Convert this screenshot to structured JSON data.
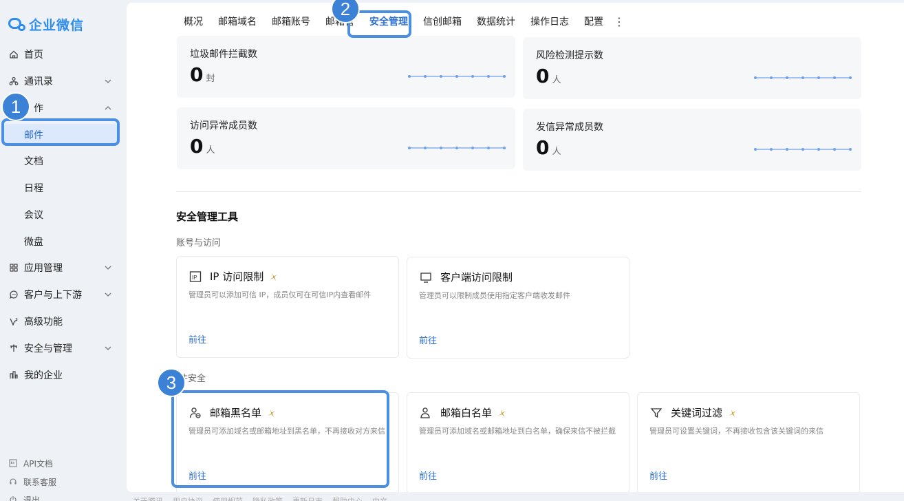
{
  "app": {
    "title": "企业微信"
  },
  "sidebar": {
    "items": [
      {
        "label": "首页",
        "icon": "home-icon"
      },
      {
        "label": "通讯录",
        "icon": "contacts-icon"
      },
      {
        "label": "作",
        "icon": "work-icon"
      },
      {
        "label": "应用管理",
        "icon": "apps-icon"
      },
      {
        "label": "客户与上下游",
        "icon": "customer-icon"
      },
      {
        "label": "高级功能",
        "icon": "advanced-icon"
      },
      {
        "label": "安全与管理",
        "icon": "security-icon"
      },
      {
        "label": "我的企业",
        "icon": "enterprise-icon"
      }
    ],
    "sub_items": [
      {
        "label": "邮件",
        "active": true
      },
      {
        "label": "文档"
      },
      {
        "label": "日程"
      },
      {
        "label": "会议"
      },
      {
        "label": "微盘"
      }
    ],
    "footer": [
      {
        "label": "API文档",
        "icon": "api-doc-icon"
      },
      {
        "label": "联系客服",
        "icon": "headset-icon"
      },
      {
        "label": "退出",
        "icon": "power-icon"
      }
    ]
  },
  "tabs": {
    "items": [
      {
        "label": "概况"
      },
      {
        "label": "邮箱域名"
      },
      {
        "label": "邮箱账号"
      },
      {
        "label": "邮箱管"
      },
      {
        "label": "安全管理",
        "active": true
      },
      {
        "label": "信创邮箱"
      },
      {
        "label": "数据统计"
      },
      {
        "label": "操作日志"
      },
      {
        "label": "配置"
      }
    ],
    "more_icon": "more-vertical-icon"
  },
  "stats": [
    {
      "title": "垃圾邮件拦截数",
      "value": "0",
      "unit": "封",
      "trend": [
        0,
        0,
        0,
        0,
        0,
        0,
        0
      ]
    },
    {
      "title": "风险检测提示数",
      "value": "0",
      "unit": "人",
      "trend": [
        0,
        0,
        0,
        0,
        0,
        0,
        0
      ]
    },
    {
      "title": "访问异常成员数",
      "value": "0",
      "unit": "人",
      "trend": [
        0,
        0,
        0,
        0,
        0,
        0,
        0
      ]
    },
    {
      "title": "发信异常成员数",
      "value": "0",
      "unit": "人",
      "trend": [
        0,
        0,
        0,
        0,
        0,
        0,
        0
      ]
    }
  ],
  "tools": {
    "section_title": "安全管理工具",
    "account_group": "账号与访问",
    "mail_group": "件安全",
    "account_cards": [
      {
        "name": "IP 访问限制",
        "desc": "管理员可以添加可信 IP，成员仅可在可信IP内查看邮件",
        "link": "前往",
        "icon": "ip-icon"
      },
      {
        "name": "客户端访问限制",
        "desc": "管理员可以限制成员使用指定客户端收发邮件",
        "link": "前往",
        "icon": "monitor-icon"
      }
    ],
    "mail_cards": [
      {
        "name": "邮箱黑名单",
        "desc": "管理员可添加域名或邮箱地址到黑名单，不再接收对方来信",
        "link": "前往",
        "icon": "user-block-icon"
      },
      {
        "name": "邮箱白名单",
        "desc": "管理员可添加域名或邮箱地址到白名单，确保来信不被拦截",
        "link": "前往",
        "icon": "user-allow-icon"
      },
      {
        "name": "关键词过滤",
        "desc": "管理员可设置关键词，不再接收包含该关键词的来信",
        "link": "前往",
        "icon": "filter-icon"
      }
    ]
  },
  "footer_links": [
    "关于腾讯",
    "用户协议",
    "使用规范",
    "隐私政策",
    "更新日志",
    "帮助中心",
    "中文"
  ],
  "annotations": [
    "1",
    "2",
    "3"
  ],
  "colors": {
    "accent": "#2b6fd6",
    "annotation": "#4a8fe3",
    "sidebar_bg": "#eef1f5"
  }
}
